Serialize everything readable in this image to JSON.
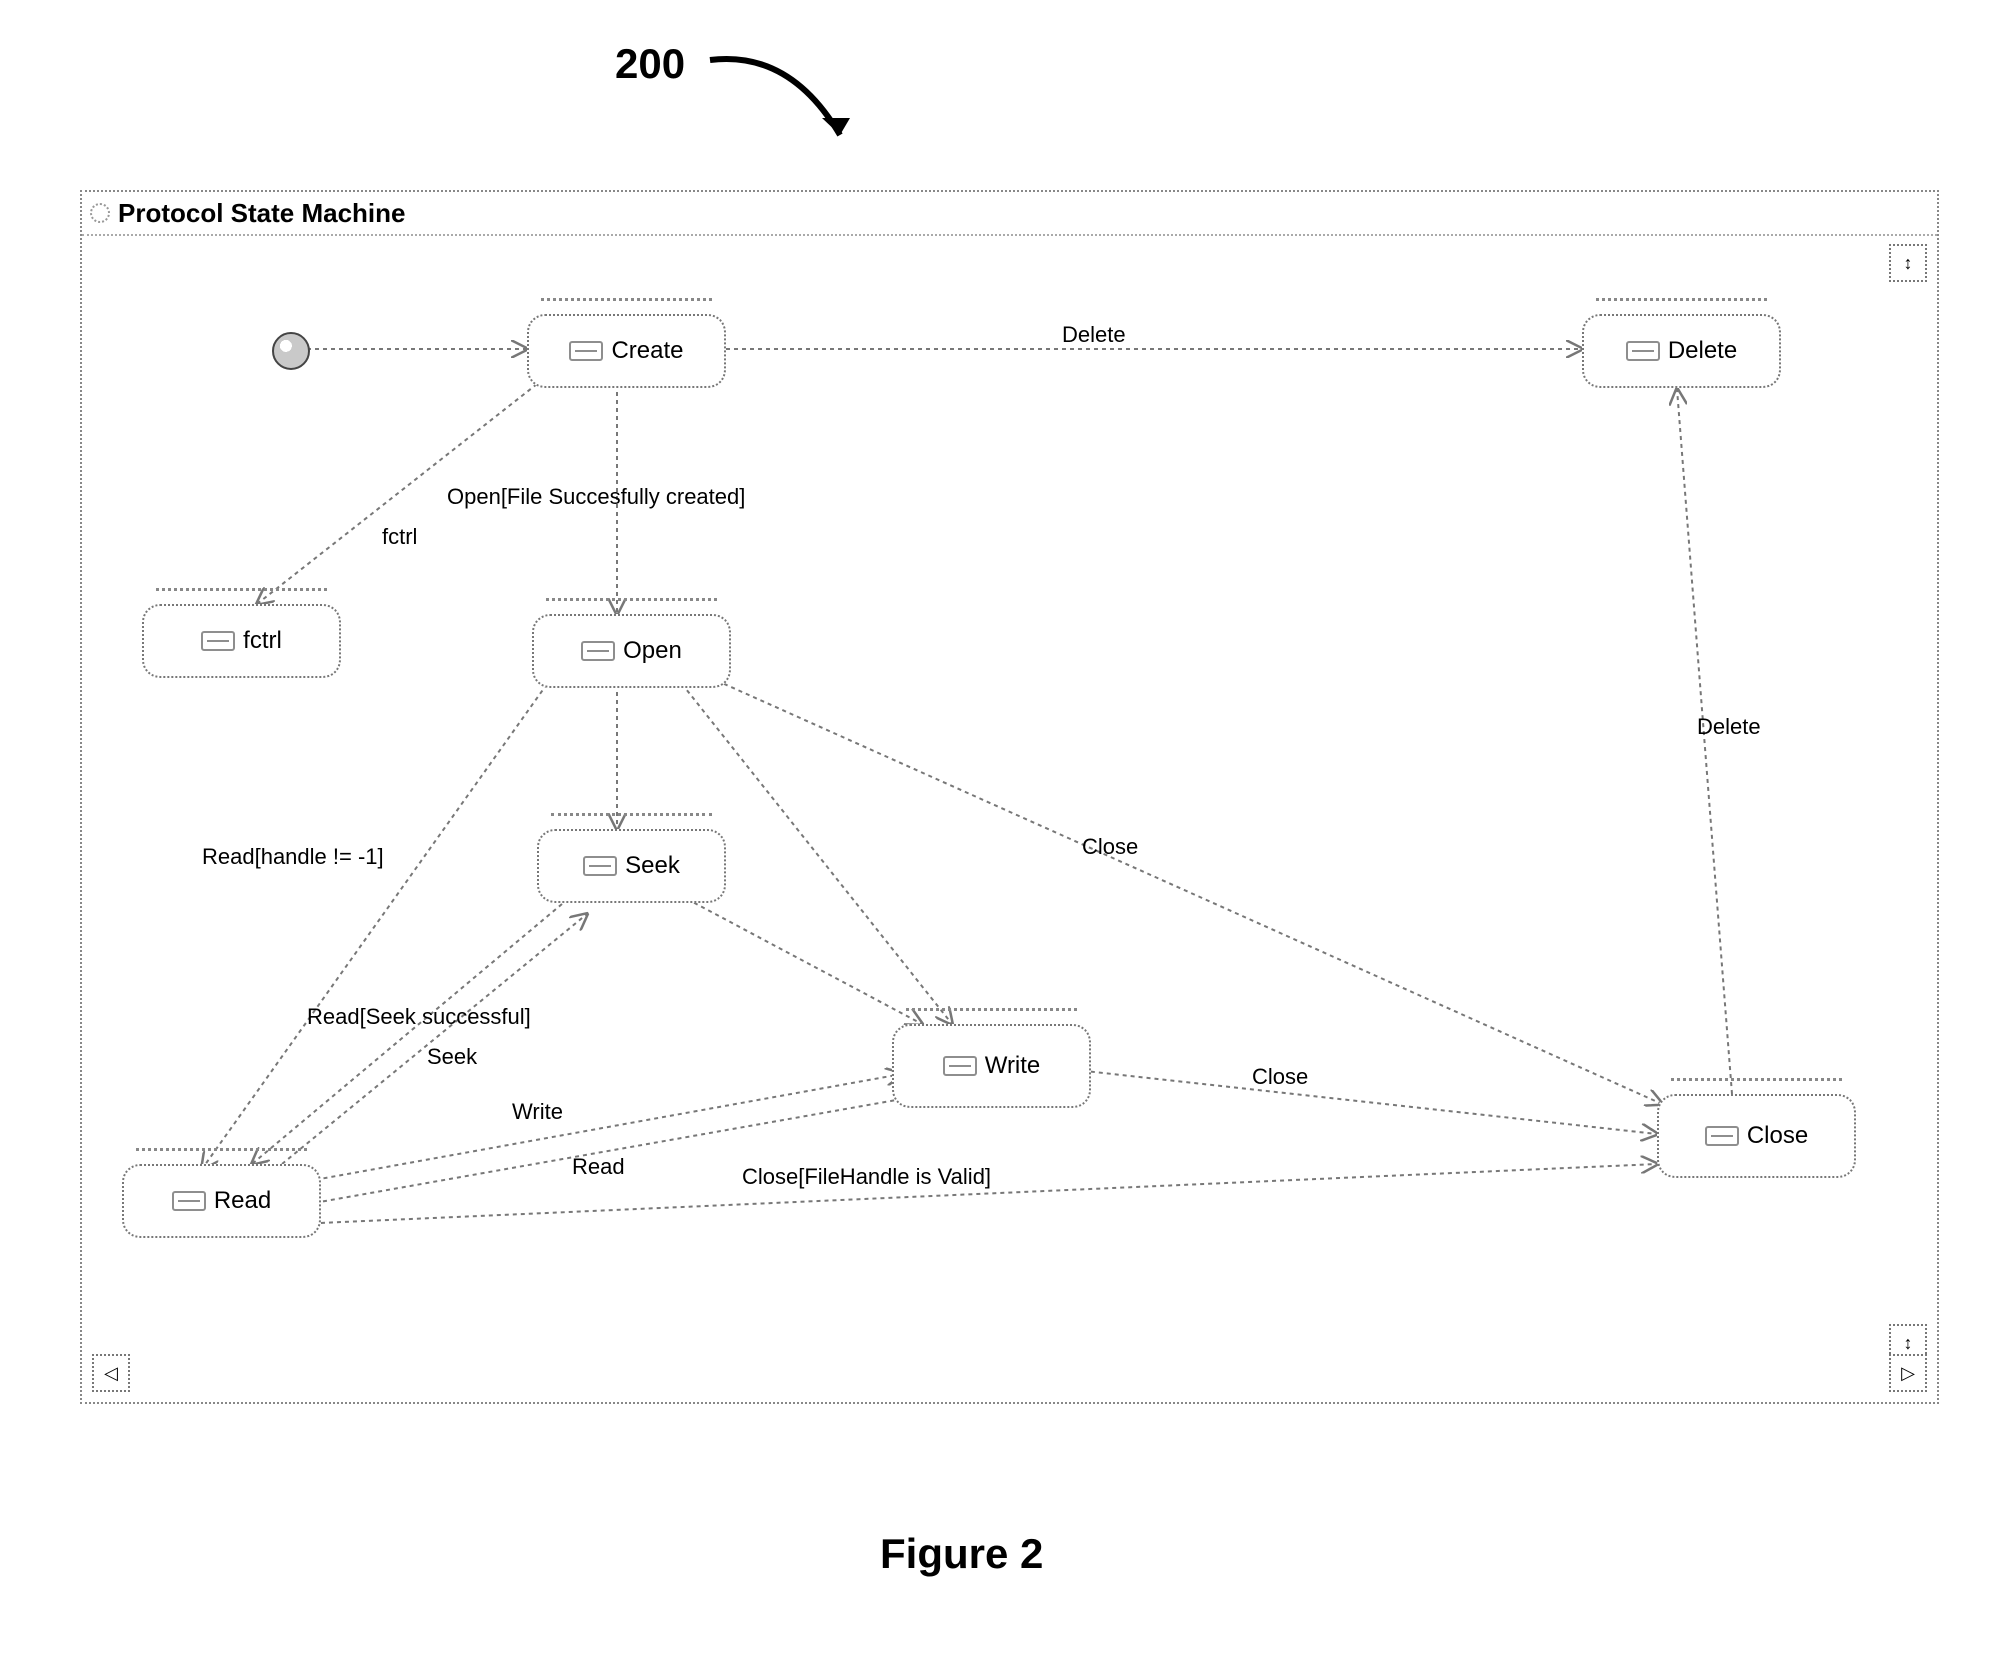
{
  "figure": {
    "reference_number": "200",
    "caption": "Figure 2"
  },
  "diagram": {
    "title": "Protocol State Machine",
    "type": "UML Protocol State Machine"
  },
  "states": {
    "create": "Create",
    "delete": "Delete",
    "fctrl": "fctrl",
    "open": "Open",
    "seek": "Seek",
    "write": "Write",
    "read": "Read",
    "close": "Close"
  },
  "transitions": {
    "create_to_delete": "Delete",
    "create_to_open": "Open[File Succesfully created]",
    "create_to_fctrl": "fctrl",
    "open_to_read": "Read[handle != -1]",
    "open_to_close": "Close",
    "seek_to_read": "Read[Seek successful]",
    "read_to_seek": "Seek",
    "read_to_write": "Write",
    "write_to_read": "Read",
    "write_to_close": "Close",
    "read_to_close": "Close[FileHandle is Valid]",
    "close_to_delete": "Delete"
  },
  "nav": {
    "up": "↕",
    "left": "◁",
    "right": "▷"
  }
}
